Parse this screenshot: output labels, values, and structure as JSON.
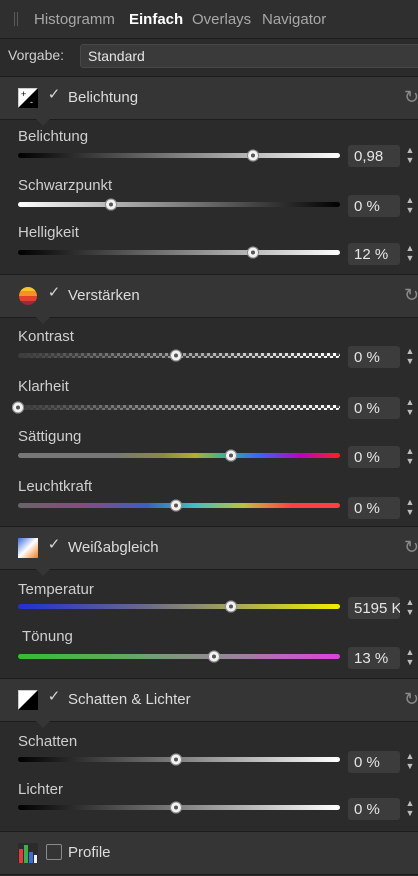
{
  "tabs": [
    "Histogramm",
    "Einfach",
    "Overlays",
    "Navigator"
  ],
  "preset": {
    "label": "Vorgabe:",
    "value": "Standard"
  },
  "sections": [
    {
      "title": "Belichtung",
      "checked": true,
      "icon": "exposure-icon",
      "sliders": [
        {
          "label": "Belichtung",
          "value": "0,98",
          "position": 0.73,
          "track": "dark-to-light"
        },
        {
          "label": "Schwarzpunkt",
          "value": "0 %",
          "position": 0.29,
          "track": "light-to-dark"
        },
        {
          "label": "Helligkeit",
          "value": "12 %",
          "position": 0.73,
          "track": "dark-to-light"
        }
      ]
    },
    {
      "title": "Verstärken",
      "checked": true,
      "icon": "enhance-icon",
      "sliders": [
        {
          "label": "Kontrast",
          "value": "0 %",
          "position": 0.49,
          "track": "checker"
        },
        {
          "label": "Klarheit",
          "value": "0 %",
          "position": 0.0,
          "track": "checker"
        },
        {
          "label": "Sättigung",
          "value": "0 %",
          "position": 0.66,
          "track": "spectrum"
        },
        {
          "label": "Leuchtkraft",
          "value": "0 %",
          "position": 0.49,
          "track": "spectrum"
        }
      ]
    },
    {
      "title": "Weißabgleich",
      "checked": true,
      "icon": "white-balance-icon",
      "sliders": [
        {
          "label": "Temperatur",
          "value": "5195 K",
          "position": 0.66,
          "track": "blue-to-yellow"
        },
        {
          "label": "Tönung",
          "value": "13 %",
          "position": 0.61,
          "track": "green-to-magenta"
        }
      ]
    },
    {
      "title": "Schatten & Lichter",
      "checked": true,
      "icon": "shadows-highlights-icon",
      "sliders": [
        {
          "label": "Schatten",
          "value": "0 %",
          "position": 0.49,
          "track": "dark-to-light"
        },
        {
          "label": "Lichter",
          "value": "0 %",
          "position": 0.49,
          "track": "dark-to-light"
        }
      ]
    },
    {
      "title": "Profile",
      "checked": false,
      "icon": "profile-icon",
      "sliders": []
    }
  ]
}
